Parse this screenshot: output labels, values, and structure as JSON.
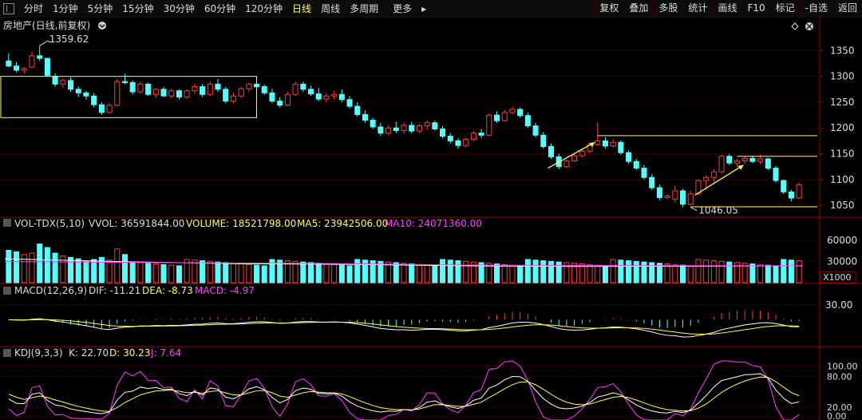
{
  "toolbar": {
    "periods": [
      "分时",
      "1分钟",
      "5分钟",
      "15分钟",
      "30分钟",
      "60分钟",
      "120分钟",
      "日线",
      "周线",
      "多周期",
      "更多"
    ],
    "more_arrow": "▸",
    "active_period": "日线",
    "tools": [
      "复权",
      "叠加",
      "多股",
      "统计",
      "画线",
      "F10",
      "标记",
      "-自选",
      "返回"
    ]
  },
  "main": {
    "title": "房地产(日线,前复权)",
    "high_label": "1359.62",
    "low_label": "1046.05",
    "y_ticks": [
      "1350",
      "1300",
      "1250",
      "1200",
      "1150",
      "1100",
      "1050"
    ]
  },
  "volume": {
    "label": "VOL-TDX(5,10)",
    "vvol": "VVOL: 36591844.00",
    "volume": "VOLUME: 18521798.00",
    "ma5": "MA5: 23942506.00",
    "ma10": "MA10: 24071360.00",
    "y_ticks": [
      "60000",
      "30000"
    ],
    "unit": "X1000"
  },
  "macd": {
    "label": "MACD(12,26,9)",
    "dif": "DIF: -11.21",
    "dea": "DEA: -8.73",
    "macd": "MACD: -4.97",
    "y_ticks": [
      "30.00"
    ]
  },
  "kdj": {
    "label": "KDJ(9,3,3)",
    "k": "K: 22.70",
    "d": "D: 30.23",
    "j": "J: 7.64",
    "y_ticks": [
      "100.00",
      "80.00",
      "20.00",
      "0.00"
    ]
  },
  "colors": {
    "up": "#ff3c3c",
    "down": "#54ffff",
    "yellow": "#ffff4a",
    "magenta": "#ff3cff",
    "white": "#ffffff",
    "grid": "#5a0000",
    "axis": "#9a0000"
  },
  "chart_data": {
    "type": "candlestick",
    "ohlc": [
      [
        1330,
        1345,
        1318,
        1320
      ],
      [
        1320,
        1328,
        1308,
        1312
      ],
      [
        1312,
        1318,
        1305,
        1315
      ],
      [
        1318,
        1348,
        1316,
        1340
      ],
      [
        1340,
        1359.62,
        1330,
        1335
      ],
      [
        1335,
        1336,
        1300,
        1302
      ],
      [
        1300,
        1306,
        1280,
        1285
      ],
      [
        1285,
        1296,
        1278,
        1292
      ],
      [
        1292,
        1298,
        1270,
        1275
      ],
      [
        1275,
        1280,
        1260,
        1268
      ],
      [
        1268,
        1272,
        1255,
        1262
      ],
      [
        1262,
        1268,
        1240,
        1245
      ],
      [
        1245,
        1250,
        1225,
        1230
      ],
      [
        1230,
        1248,
        1228,
        1244
      ],
      [
        1244,
        1295,
        1242,
        1290
      ],
      [
        1290,
        1305,
        1285,
        1288
      ],
      [
        1288,
        1292,
        1265,
        1270
      ],
      [
        1270,
        1290,
        1266,
        1285
      ],
      [
        1285,
        1288,
        1262,
        1265
      ],
      [
        1265,
        1278,
        1258,
        1275
      ],
      [
        1275,
        1280,
        1260,
        1262
      ],
      [
        1262,
        1276,
        1258,
        1272
      ],
      [
        1272,
        1275,
        1255,
        1260
      ],
      [
        1260,
        1275,
        1256,
        1272
      ],
      [
        1272,
        1285,
        1266,
        1280
      ],
      [
        1280,
        1285,
        1260,
        1265
      ],
      [
        1265,
        1290,
        1262,
        1285
      ],
      [
        1285,
        1295,
        1270,
        1275
      ],
      [
        1275,
        1280,
        1248,
        1252
      ],
      [
        1252,
        1268,
        1248,
        1262
      ],
      [
        1262,
        1280,
        1258,
        1276
      ],
      [
        1276,
        1288,
        1270,
        1285
      ],
      [
        1285,
        1292,
        1276,
        1280
      ],
      [
        1280,
        1284,
        1264,
        1268
      ],
      [
        1268,
        1276,
        1248,
        1252
      ],
      [
        1252,
        1260,
        1240,
        1244
      ],
      [
        1244,
        1270,
        1242,
        1265
      ],
      [
        1265,
        1290,
        1262,
        1285
      ],
      [
        1285,
        1290,
        1270,
        1275
      ],
      [
        1275,
        1282,
        1262,
        1266
      ],
      [
        1266,
        1278,
        1252,
        1256
      ],
      [
        1256,
        1268,
        1250,
        1262
      ],
      [
        1262,
        1272,
        1255,
        1265
      ],
      [
        1265,
        1275,
        1250,
        1255
      ],
      [
        1255,
        1262,
        1238,
        1242
      ],
      [
        1242,
        1250,
        1222,
        1226
      ],
      [
        1226,
        1234,
        1210,
        1215
      ],
      [
        1215,
        1220,
        1198,
        1202
      ],
      [
        1202,
        1210,
        1185,
        1190
      ],
      [
        1190,
        1205,
        1186,
        1200
      ],
      [
        1200,
        1212,
        1190,
        1195
      ],
      [
        1195,
        1210,
        1188,
        1205
      ],
      [
        1205,
        1212,
        1190,
        1194
      ],
      [
        1194,
        1208,
        1190,
        1204
      ],
      [
        1204,
        1215,
        1196,
        1210
      ],
      [
        1210,
        1214,
        1195,
        1198
      ],
      [
        1198,
        1204,
        1180,
        1184
      ],
      [
        1184,
        1190,
        1170,
        1175
      ],
      [
        1175,
        1180,
        1160,
        1166
      ],
      [
        1166,
        1182,
        1162,
        1178
      ],
      [
        1178,
        1195,
        1174,
        1190
      ],
      [
        1190,
        1198,
        1180,
        1186
      ],
      [
        1186,
        1228,
        1184,
        1225
      ],
      [
        1225,
        1232,
        1210,
        1214
      ],
      [
        1214,
        1235,
        1212,
        1230
      ],
      [
        1230,
        1242,
        1226,
        1236
      ],
      [
        1236,
        1240,
        1220,
        1224
      ],
      [
        1224,
        1230,
        1200,
        1204
      ],
      [
        1204,
        1210,
        1182,
        1186
      ],
      [
        1186,
        1192,
        1160,
        1164
      ],
      [
        1164,
        1170,
        1140,
        1144
      ],
      [
        1144,
        1150,
        1120,
        1125
      ],
      [
        1125,
        1140,
        1122,
        1136
      ],
      [
        1136,
        1150,
        1134,
        1146
      ],
      [
        1146,
        1160,
        1142,
        1155
      ],
      [
        1155,
        1172,
        1150,
        1168
      ],
      [
        1168,
        1210,
        1165,
        1175
      ],
      [
        1175,
        1182,
        1160,
        1165
      ],
      [
        1165,
        1178,
        1162,
        1172
      ],
      [
        1172,
        1176,
        1148,
        1152
      ],
      [
        1152,
        1156,
        1130,
        1135
      ],
      [
        1135,
        1140,
        1118,
        1122
      ],
      [
        1122,
        1128,
        1100,
        1104
      ],
      [
        1104,
        1110,
        1080,
        1084
      ],
      [
        1084,
        1090,
        1060,
        1065
      ],
      [
        1065,
        1072,
        1062,
        1068
      ],
      [
        1062,
        1088,
        1055,
        1078
      ],
      [
        1078,
        1082,
        1046.05,
        1052
      ],
      [
        1052,
        1078,
        1050,
        1072
      ],
      [
        1072,
        1100,
        1070,
        1098
      ],
      [
        1098,
        1108,
        1080,
        1104
      ],
      [
        1104,
        1120,
        1095,
        1115
      ],
      [
        1115,
        1148,
        1112,
        1145
      ],
      [
        1145,
        1150,
        1128,
        1132
      ],
      [
        1132,
        1140,
        1124,
        1136
      ],
      [
        1136,
        1145,
        1130,
        1141
      ],
      [
        1141,
        1146,
        1132,
        1135
      ],
      [
        1135,
        1148,
        1130,
        1140
      ],
      [
        1140,
        1142,
        1118,
        1122
      ],
      [
        1122,
        1126,
        1094,
        1098
      ],
      [
        1098,
        1100,
        1072,
        1076
      ],
      [
        1076,
        1080,
        1058,
        1064
      ],
      [
        1064,
        1094,
        1062,
        1090
      ]
    ],
    "ylim": [
      1030,
      1380
    ],
    "price_lines": [
      1300,
      1220,
      1185,
      1145,
      1047
    ],
    "volume": {
      "ylim": [
        0,
        75000
      ],
      "ma5": [
        34000,
        30000,
        27000,
        26000,
        24000,
        23000,
        23500,
        23942.506
      ],
      "ma10": [
        30000,
        29000,
        28000,
        27000,
        25000,
        24500,
        24200,
        24071.36
      ]
    },
    "macd": {
      "ylim": [
        -50,
        45
      ]
    },
    "kdj": {
      "ylim": [
        -5,
        110
      ]
    }
  }
}
